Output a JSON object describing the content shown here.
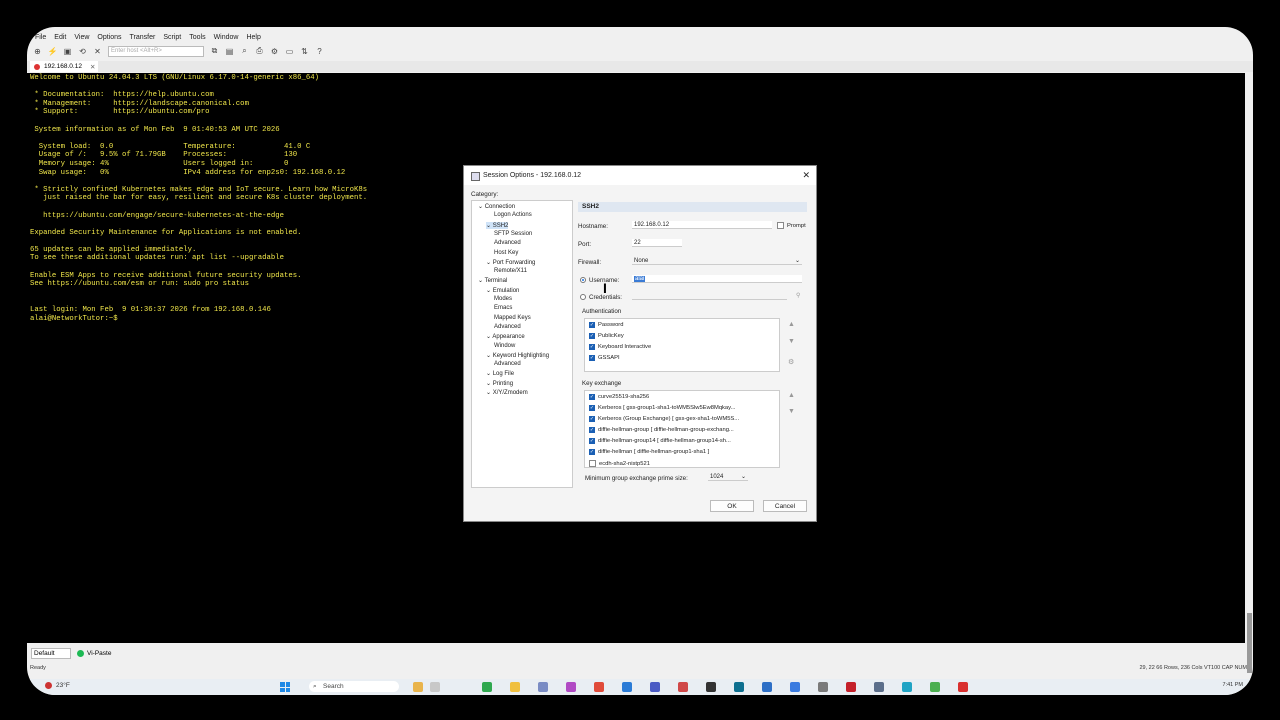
{
  "menu": [
    "File",
    "Edit",
    "View",
    "Options",
    "Transfer",
    "Script",
    "Tools",
    "Window",
    "Help"
  ],
  "toolbar": {
    "host_placeholder": "Enter host <Alt+R>"
  },
  "tab": {
    "label": "192.168.0.12"
  },
  "terminal": {
    "lines": [
      "Welcome to Ubuntu 24.04.3 LTS (GNU/Linux 6.17.0-14-generic x86_64)",
      "",
      " * Documentation:  https://help.ubuntu.com",
      " * Management:     https://landscape.canonical.com",
      " * Support:        https://ubuntu.com/pro",
      "",
      " System information as of Mon Feb  9 01:40:53 AM UTC 2026",
      "",
      "  System load:  0.0                Temperature:           41.0 C",
      "  Usage of /:   9.5% of 71.79GB    Processes:             130",
      "  Memory usage: 4%                 Users logged in:       0",
      "  Swap usage:   0%                 IPv4 address for enp2s0: 192.168.0.12",
      "",
      " * Strictly confined Kubernetes makes edge and IoT secure. Learn how MicroK8s",
      "   just raised the bar for easy, resilient and secure K8s cluster deployment.",
      "",
      "   https://ubuntu.com/engage/secure-kubernetes-at-the-edge",
      "",
      "Expanded Security Maintenance for Applications is not enabled.",
      "",
      "65 updates can be applied immediately.",
      "To see these additional updates run: apt list --upgradable",
      "",
      "Enable ESM Apps to receive additional future security updates.",
      "See https://ubuntu.com/esm or run: sudo pro status",
      "",
      "",
      "Last login: Mon Feb  9 01:36:37 2026 from 192.168.0.146",
      "alai@NetworkTutor:~$"
    ]
  },
  "buttonbar": {
    "session": "Default",
    "vpaste": "Vi-Paste"
  },
  "status": {
    "ready": "Ready",
    "right": "29, 22   66 Rows, 236 Cols   VT100   CAP NUM"
  },
  "taskbar": {
    "weather": "23°F",
    "search": "Search",
    "clock": "7:41 PM"
  },
  "dialog": {
    "title": "Session Options - 192.168.0.12",
    "category_label": "Category:",
    "tree": [
      {
        "label": "Connection",
        "level": 0
      },
      {
        "label": "Logon Actions",
        "level": 2
      },
      {
        "label": "SSH2",
        "level": 1,
        "selected": true
      },
      {
        "label": "SFTP Session",
        "level": 2
      },
      {
        "label": "Advanced",
        "level": 2
      },
      {
        "label": "Host Key",
        "level": 2
      },
      {
        "label": "Port Forwarding",
        "level": 1
      },
      {
        "label": "Remote/X11",
        "level": 2
      },
      {
        "label": "Terminal",
        "level": 0
      },
      {
        "label": "Emulation",
        "level": 1
      },
      {
        "label": "Modes",
        "level": 2
      },
      {
        "label": "Emacs",
        "level": 2
      },
      {
        "label": "Mapped Keys",
        "level": 2
      },
      {
        "label": "Advanced",
        "level": 2
      },
      {
        "label": "Appearance",
        "level": 1
      },
      {
        "label": "Window",
        "level": 2
      },
      {
        "label": "Keyword Highlighting",
        "level": 1
      },
      {
        "label": "Advanced",
        "level": 2
      },
      {
        "label": "Log File",
        "level": 1
      },
      {
        "label": "Printing",
        "level": 1
      },
      {
        "label": "X/Y/Zmodem",
        "level": 1
      }
    ],
    "panel_title": "SSH2",
    "hostname_label": "Hostname:",
    "hostname_value": "192.168.0.12",
    "prompt_label": "Prompt",
    "port_label": "Port:",
    "port_value": "22",
    "firewall_label": "Firewall:",
    "firewall_value": "None",
    "username_label": "Username:",
    "username_value": "alai",
    "credentials_label": "Credentials:",
    "authentication_label": "Authentication",
    "auth": [
      {
        "label": "Password",
        "checked": true
      },
      {
        "label": "PublicKey",
        "checked": true
      },
      {
        "label": "Keyboard Interactive",
        "checked": true
      },
      {
        "label": "GSSAPI",
        "checked": true
      }
    ],
    "kex_label": "Key exchange",
    "kex": [
      {
        "label": "curve25519-sha256",
        "checked": true
      },
      {
        "label": "Kerberos [ gss-group1-sha1-toWM5Slw5Ew8Mqkay...",
        "checked": true
      },
      {
        "label": "Kerberos (Group Exchange) [ gss-gex-sha1-toWM5S...",
        "checked": true
      },
      {
        "label": "diffie-hellman-group [ diffie-hellman-group-exchang...",
        "checked": true
      },
      {
        "label": "diffie-hellman-group14 [ diffie-hellman-group14-sh...",
        "checked": true
      },
      {
        "label": "diffie-hellman [ diffie-hellman-group1-sha1 ]",
        "checked": true
      },
      {
        "label": "ecdh-sha2-nistp521",
        "checked": false
      }
    ],
    "min_group_label": "Minimum group exchange prime size:",
    "min_group_value": "1024",
    "ok": "OK",
    "cancel": "Cancel"
  },
  "colors": {
    "terminal_text": "#f2e84b",
    "terminal_bg": "#000000",
    "accent": "#1a5fb4"
  }
}
